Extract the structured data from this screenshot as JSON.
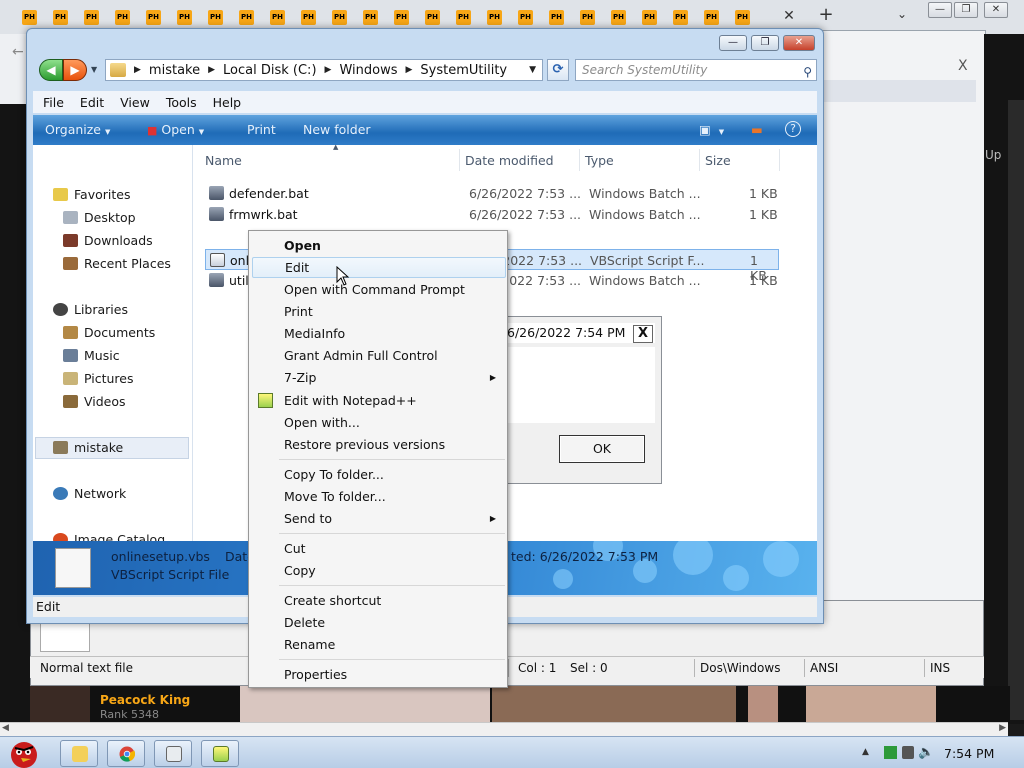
{
  "browser": {
    "tab_label": "PH",
    "tab_count": 24
  },
  "explorer": {
    "breadcrumbs": [
      "mistake",
      "Local Disk (C:)",
      "Windows",
      "SystemUtility"
    ],
    "search_placeholder": "Search SystemUtility",
    "menu": [
      "File",
      "Edit",
      "View",
      "Tools",
      "Help"
    ],
    "commands": {
      "organize": "Organize",
      "open": "Open",
      "print": "Print",
      "new_folder": "New folder"
    },
    "nav": {
      "favorites": "Favorites",
      "desktop": "Desktop",
      "downloads": "Downloads",
      "recent": "Recent Places",
      "libraries": "Libraries",
      "documents": "Documents",
      "music": "Music",
      "pictures": "Pictures",
      "videos": "Videos",
      "mistake": "mistake",
      "network": "Network",
      "image_catalog": "Image Catalog"
    },
    "columns": {
      "name": "Name",
      "date": "Date modified",
      "type": "Type",
      "size": "Size"
    },
    "files": [
      {
        "name": "defender.bat",
        "date": "6/26/2022 7:53 ...",
        "type": "Windows Batch ...",
        "size": "1 KB"
      },
      {
        "name": "frmwrk.bat",
        "date": "6/26/2022 7:53 ...",
        "type": "Windows Batch ...",
        "size": "1 KB"
      },
      {
        "name": "onlinesetup.vbs",
        "date": "6/26/2022 7:53 ...",
        "type": "VBScript Script F...",
        "size": "1 KB"
      },
      {
        "name": "util",
        "date": "6/26/2022 7:53 ...",
        "type": "Windows Batch ...",
        "size": "1 KB"
      }
    ],
    "details": {
      "name": "onlinesetup.vbs",
      "type": "VBScript Script File",
      "date_label": "Date",
      "created": "ted: 6/26/2022 7:53 PM"
    },
    "status": "Edit"
  },
  "msgbox": {
    "text": "6/26/2022 7:54 PM",
    "close": "X",
    "ok": "OK"
  },
  "context_menu": {
    "open": "Open",
    "edit": "Edit",
    "open_cmd": "Open with Command Prompt",
    "print": "Print",
    "mediainfo": "MediaInfo",
    "grant_admin": "Grant Admin Full Control",
    "zip": "7-Zip",
    "notepadpp": "Edit with Notepad++",
    "open_with": "Open with...",
    "restore": "Restore previous versions",
    "copy_to": "Copy To folder...",
    "move_to": "Move To folder...",
    "send_to": "Send to",
    "cut": "Cut",
    "copy": "Copy",
    "create_shortcut": "Create shortcut",
    "delete": "Delete",
    "rename": "Rename",
    "properties": "Properties"
  },
  "notepad_status": {
    "left": "Normal text file",
    "col": "Col : 1",
    "sel": "Sel : 0",
    "path": "Dos\\Windows",
    "encoding": "ANSI",
    "mode": "INS"
  },
  "background": {
    "up_text": "Up",
    "peacock_name": "Peacock King",
    "peacock_rank": "Rank 5348"
  },
  "taskbar": {
    "clock": "7:54 PM"
  }
}
